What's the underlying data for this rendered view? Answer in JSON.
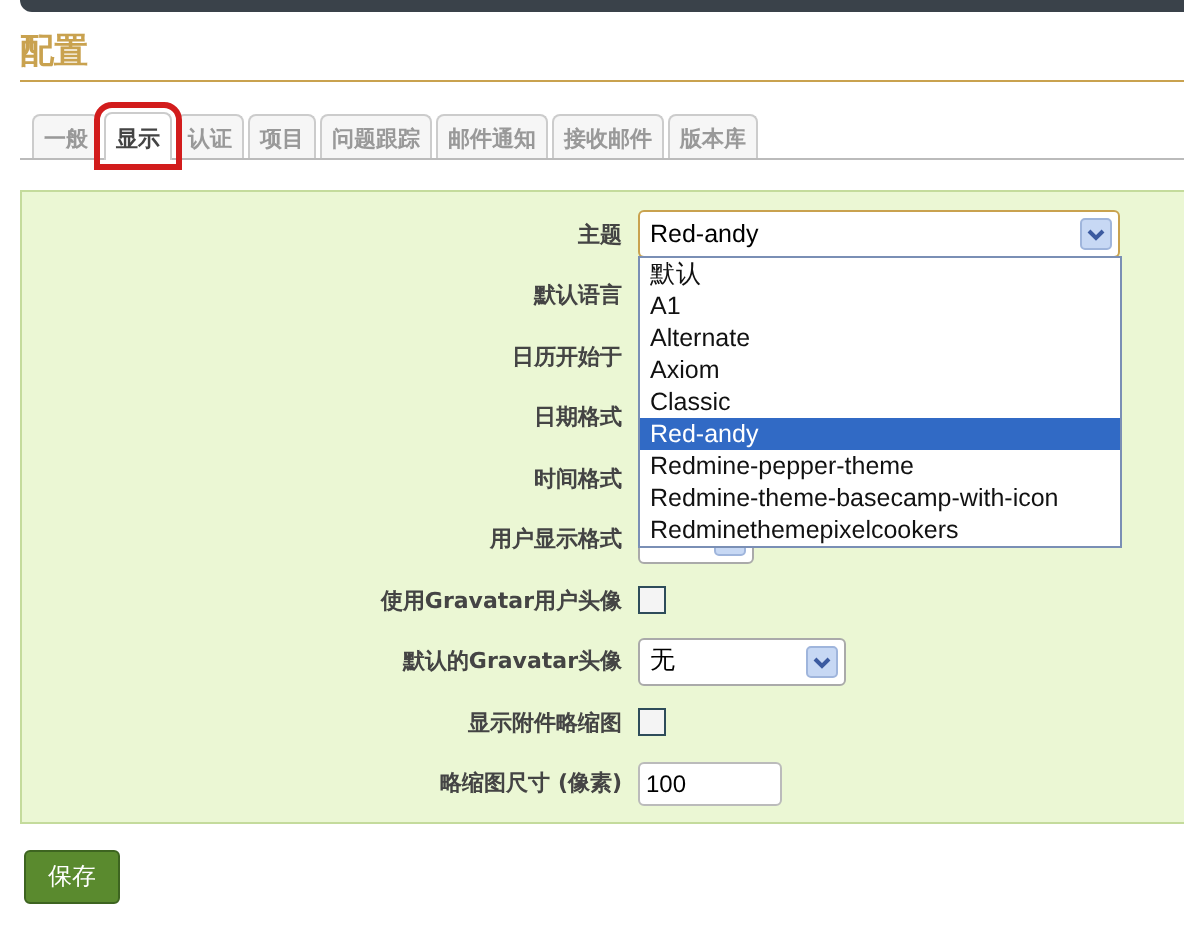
{
  "page_title": "配置",
  "tabs": [
    {
      "label": "一般",
      "selected": false,
      "annotated": false
    },
    {
      "label": "显示",
      "selected": true,
      "annotated": true
    },
    {
      "label": "认证",
      "selected": false,
      "annotated": false
    },
    {
      "label": "项目",
      "selected": false,
      "annotated": false
    },
    {
      "label": "问题跟踪",
      "selected": false,
      "annotated": false
    },
    {
      "label": "邮件通知",
      "selected": false,
      "annotated": false
    },
    {
      "label": "接收邮件",
      "selected": false,
      "annotated": false
    },
    {
      "label": "版本库",
      "selected": false,
      "annotated": false
    }
  ],
  "fields": [
    {
      "kind": "select",
      "label": "主题",
      "value": "Red-andy",
      "expanded": true
    },
    {
      "kind": "covered",
      "label": "默认语言"
    },
    {
      "kind": "covered",
      "label": "日历开始于"
    },
    {
      "kind": "covered",
      "label": "日期格式"
    },
    {
      "kind": "covered",
      "label": "时间格式"
    },
    {
      "kind": "select",
      "label": "用户显示格式",
      "expanded": false
    },
    {
      "kind": "checkbox",
      "label": "使用Gravatar用户头像",
      "checked": false
    },
    {
      "kind": "select",
      "label": "默认的Gravatar头像",
      "value": "无",
      "expanded": false
    },
    {
      "kind": "checkbox",
      "label": "显示附件略缩图",
      "checked": false
    },
    {
      "kind": "text",
      "label": "略缩图尺寸 (像素)",
      "value": "100"
    }
  ],
  "theme_options": [
    {
      "label": "默认",
      "selected": false
    },
    {
      "label": "A1",
      "selected": false
    },
    {
      "label": "Alternate",
      "selected": false
    },
    {
      "label": "Axiom",
      "selected": false
    },
    {
      "label": "Classic",
      "selected": false
    },
    {
      "label": "Red-andy",
      "selected": true
    },
    {
      "label": "Redmine-pepper-theme",
      "selected": false
    },
    {
      "label": "Redmine-theme-basecamp-with-icon",
      "selected": false
    },
    {
      "label": "Redminethemepixelcookers",
      "selected": false
    }
  ],
  "save_button": "保存"
}
